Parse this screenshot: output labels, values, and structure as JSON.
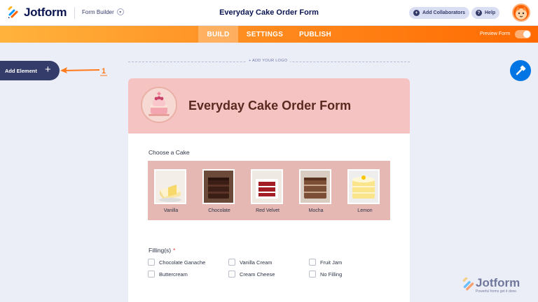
{
  "header": {
    "logo_text": "Jotform",
    "builder_menu_label": "Form Builder",
    "form_title": "Everyday Cake Order Form",
    "add_collaborators_label": "Add Collaborators",
    "help_label": "Help"
  },
  "nav": {
    "tabs": [
      {
        "label": "BUILD",
        "active": true
      },
      {
        "label": "SETTINGS",
        "active": false
      },
      {
        "label": "PUBLISH",
        "active": false
      }
    ],
    "preview_label": "Preview Form",
    "preview_enabled": false
  },
  "sidebar": {
    "add_element_label": "Add Element",
    "annotation_number": "1"
  },
  "canvas": {
    "add_logo_label": "+ ADD YOUR LOGO"
  },
  "form": {
    "title": "Everyday Cake Order Form",
    "cake_question": "Choose a Cake",
    "cakes": [
      {
        "name": "Vanilla"
      },
      {
        "name": "Chocolate"
      },
      {
        "name": "Red Velvet"
      },
      {
        "name": "Mocha"
      },
      {
        "name": "Lemon"
      }
    ],
    "filling_question": "Filling(s)",
    "filling_required_mark": "*",
    "fillings": [
      "Chocolate Ganache",
      "Vanilla Cream",
      "Fruit Jam",
      "Buttercream",
      "Cream Cheese",
      "No Filling"
    ]
  },
  "watermark": {
    "brand": "Jotform",
    "tagline": "Powerful forms get it done."
  },
  "colors": {
    "brand_navy": "#0a1551",
    "nav_orange_start": "#ffb33d",
    "nav_orange_end": "#ff6a00",
    "form_header_pink": "#f5c3c1",
    "designer_blue": "#0075e3",
    "required_red": "#f23a3c"
  },
  "icons": [
    "jotform-logo-icon",
    "chevron-down-icon",
    "add-user-icon",
    "help-icon",
    "plus-icon",
    "paint-roller-icon",
    "cake-logo-icon"
  ]
}
